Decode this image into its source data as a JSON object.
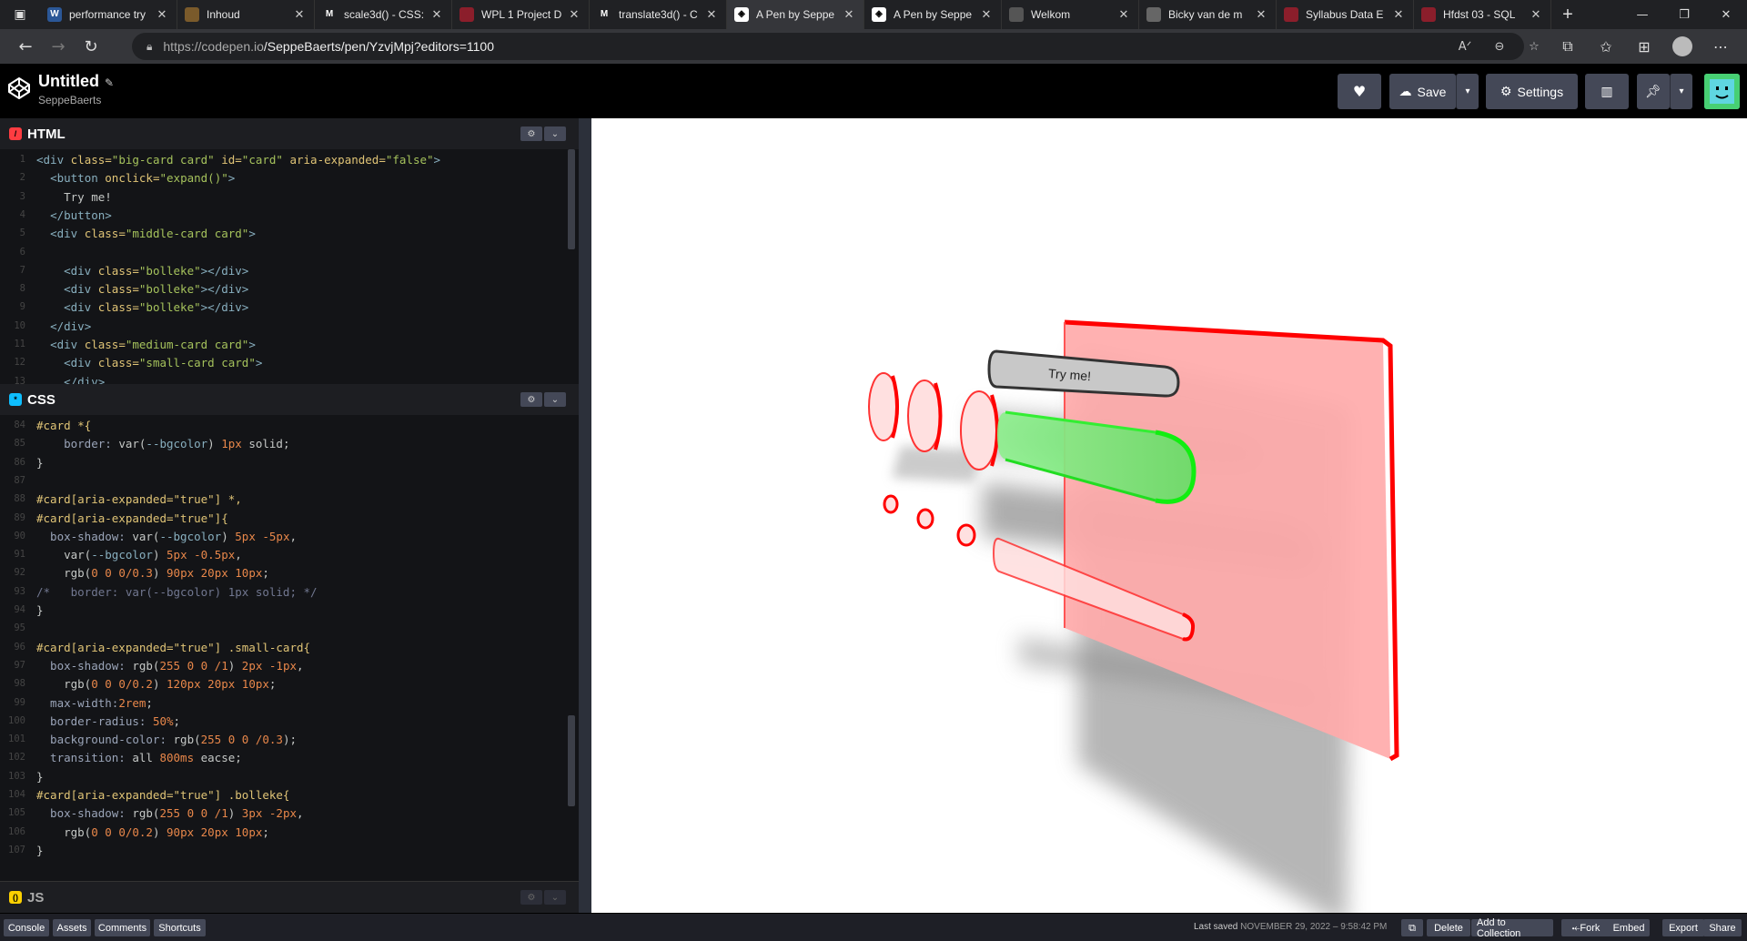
{
  "browser": {
    "tabs": [
      {
        "title": "performance try",
        "favicon": "W",
        "favicon_bg": "#2b5797",
        "active": false
      },
      {
        "title": "Inhoud",
        "favicon": "",
        "favicon_bg": "#7a5a2b",
        "active": false
      },
      {
        "title": "scale3d() - CSS:",
        "favicon": "M",
        "favicon_bg": "#202124",
        "active": false
      },
      {
        "title": "WPL 1 Project D",
        "favicon": "",
        "favicon_bg": "#8b1e2b",
        "active": false
      },
      {
        "title": "translate3d() - C",
        "favicon": "M",
        "favicon_bg": "#202124",
        "active": false
      },
      {
        "title": "A Pen by Seppe",
        "favicon": "◈",
        "favicon_bg": "#fff",
        "active": true
      },
      {
        "title": "A Pen by Seppe",
        "favicon": "◈",
        "favicon_bg": "#fff",
        "active": false
      },
      {
        "title": "Welkom",
        "favicon": "",
        "favicon_bg": "#555",
        "active": false
      },
      {
        "title": "Bicky van de m",
        "favicon": "",
        "favicon_bg": "#666",
        "active": false
      },
      {
        "title": "Syllabus Data E",
        "favicon": "",
        "favicon_bg": "#8b1e2b",
        "active": false
      },
      {
        "title": "Hfdst 03 - SQL",
        "favicon": "",
        "favicon_bg": "#8b1e2b",
        "active": false
      }
    ],
    "url_host": "https://codepen.io",
    "url_path": "/SeppeBaerts/pen/YzvjMpj?editors=1100"
  },
  "header": {
    "title": "Untitled",
    "author": "SeppeBaerts",
    "save_label": "Save",
    "settings_label": "Settings"
  },
  "panes": {
    "html_label": "HTML",
    "css_label": "CSS",
    "js_label": "JS"
  },
  "html_code": [
    {
      "n": "1",
      "t": [
        [
          "tag",
          "<div "
        ],
        [
          "attr",
          "class="
        ],
        [
          "str",
          "\"big-card card\" "
        ],
        [
          "attr",
          "id="
        ],
        [
          "str",
          "\"card\" "
        ],
        [
          "attr",
          "aria-expanded="
        ],
        [
          "str",
          "\"false\""
        ],
        [
          "tag",
          ">"
        ]
      ]
    },
    {
      "n": "2",
      "t": [
        [
          "punc",
          "  "
        ],
        [
          "tag",
          "<button "
        ],
        [
          "attr",
          "onclick="
        ],
        [
          "str",
          "\"expand()\""
        ],
        [
          "tag",
          ">"
        ]
      ]
    },
    {
      "n": "3",
      "t": [
        [
          "punc",
          "    Try me!"
        ]
      ]
    },
    {
      "n": "4",
      "t": [
        [
          "punc",
          "  "
        ],
        [
          "tag",
          "</button>"
        ]
      ]
    },
    {
      "n": "5",
      "t": [
        [
          "punc",
          "  "
        ],
        [
          "tag",
          "<div "
        ],
        [
          "attr",
          "class="
        ],
        [
          "str",
          "\"middle-card card\""
        ],
        [
          "tag",
          ">"
        ]
      ]
    },
    {
      "n": "6",
      "t": [
        [
          "punc",
          ""
        ]
      ]
    },
    {
      "n": "7",
      "t": [
        [
          "punc",
          "    "
        ],
        [
          "tag",
          "<div "
        ],
        [
          "attr",
          "class="
        ],
        [
          "str",
          "\"bolleke\""
        ],
        [
          "tag",
          "></div>"
        ]
      ]
    },
    {
      "n": "8",
      "t": [
        [
          "punc",
          "    "
        ],
        [
          "tag",
          "<div "
        ],
        [
          "attr",
          "class="
        ],
        [
          "str",
          "\"bolleke\""
        ],
        [
          "tag",
          "></div>"
        ]
      ]
    },
    {
      "n": "9",
      "t": [
        [
          "punc",
          "    "
        ],
        [
          "tag",
          "<div "
        ],
        [
          "attr",
          "class="
        ],
        [
          "str",
          "\"bolleke\""
        ],
        [
          "tag",
          "></div>"
        ]
      ]
    },
    {
      "n": "10",
      "t": [
        [
          "punc",
          "  "
        ],
        [
          "tag",
          "</div>"
        ]
      ]
    },
    {
      "n": "11",
      "t": [
        [
          "punc",
          "  "
        ],
        [
          "tag",
          "<div "
        ],
        [
          "attr",
          "class="
        ],
        [
          "str",
          "\"medium-card card\""
        ],
        [
          "tag",
          ">"
        ]
      ]
    },
    {
      "n": "12",
      "t": [
        [
          "punc",
          "    "
        ],
        [
          "tag",
          "<div "
        ],
        [
          "attr",
          "class="
        ],
        [
          "str",
          "\"small-card card\""
        ],
        [
          "tag",
          ">"
        ]
      ]
    },
    {
      "n": "13",
      "t": [
        [
          "punc",
          "    "
        ],
        [
          "tag",
          "</div>"
        ]
      ]
    }
  ],
  "css_code": [
    {
      "n": "84",
      "t": [
        [
          "sel",
          "#card *{"
        ]
      ]
    },
    {
      "n": "85",
      "t": [
        [
          "prop",
          "    border: "
        ],
        [
          "fn",
          "var("
        ],
        [
          "var",
          "--bgcolor"
        ],
        [
          "fn",
          ") "
        ],
        [
          "num",
          "1px "
        ],
        [
          "fn",
          "solid;"
        ]
      ]
    },
    {
      "n": "86",
      "t": [
        [
          "punc",
          "}"
        ]
      ]
    },
    {
      "n": "87",
      "t": [
        [
          "punc",
          ""
        ]
      ]
    },
    {
      "n": "88",
      "t": [
        [
          "sel",
          "#card[aria-expanded=\"true\"] *,"
        ]
      ]
    },
    {
      "n": "89",
      "t": [
        [
          "sel",
          "#card[aria-expanded=\"true\"]{"
        ]
      ]
    },
    {
      "n": "90",
      "t": [
        [
          "prop",
          "  box-shadow: "
        ],
        [
          "fn",
          "var("
        ],
        [
          "var",
          "--bgcolor"
        ],
        [
          "fn",
          ") "
        ],
        [
          "num",
          "5px -5px"
        ],
        [
          "fn",
          ","
        ]
      ]
    },
    {
      "n": "91",
      "t": [
        [
          "prop",
          "    "
        ],
        [
          "fn",
          "var("
        ],
        [
          "var",
          "--bgcolor"
        ],
        [
          "fn",
          ") "
        ],
        [
          "num",
          "5px -0.5px"
        ],
        [
          "fn",
          ","
        ]
      ]
    },
    {
      "n": "92",
      "t": [
        [
          "prop",
          "    "
        ],
        [
          "fn",
          "rgb("
        ],
        [
          "num",
          "0 0 0/0.3"
        ],
        [
          "fn",
          ") "
        ],
        [
          "num",
          "90px 20px 10px"
        ],
        [
          "fn",
          ";"
        ]
      ]
    },
    {
      "n": "93",
      "t": [
        [
          "cm",
          "/*   border: var(--bgcolor) 1px solid; */"
        ]
      ]
    },
    {
      "n": "94",
      "t": [
        [
          "punc",
          "}"
        ]
      ]
    },
    {
      "n": "95",
      "t": [
        [
          "punc",
          ""
        ]
      ]
    },
    {
      "n": "96",
      "t": [
        [
          "sel",
          "#card[aria-expanded=\"true\"] .small-card{"
        ]
      ]
    },
    {
      "n": "97",
      "t": [
        [
          "prop",
          "  box-shadow: "
        ],
        [
          "fn",
          "rgb("
        ],
        [
          "num",
          "255 0 0 /1"
        ],
        [
          "fn",
          ") "
        ],
        [
          "num",
          "2px -1px"
        ],
        [
          "fn",
          ","
        ]
      ]
    },
    {
      "n": "98",
      "t": [
        [
          "prop",
          "    "
        ],
        [
          "fn",
          "rgb("
        ],
        [
          "num",
          "0 0 0/0.2"
        ],
        [
          "fn",
          ") "
        ],
        [
          "num",
          "120px 20px 10px"
        ],
        [
          "fn",
          ";"
        ]
      ]
    },
    {
      "n": "99",
      "t": [
        [
          "prop",
          "  max-width:"
        ],
        [
          "num",
          "2rem"
        ],
        [
          "fn",
          ";"
        ]
      ]
    },
    {
      "n": "100",
      "t": [
        [
          "prop",
          "  border-radius: "
        ],
        [
          "num",
          "50%"
        ],
        [
          "fn",
          ";"
        ]
      ]
    },
    {
      "n": "101",
      "t": [
        [
          "prop",
          "  background-color: "
        ],
        [
          "fn",
          "rgb("
        ],
        [
          "num",
          "255 0 0 /0.3"
        ],
        [
          "fn",
          ");"
        ]
      ]
    },
    {
      "n": "102",
      "t": [
        [
          "prop",
          "  transition: "
        ],
        [
          "fn",
          "all "
        ],
        [
          "num",
          "800ms "
        ],
        [
          "fn",
          "eacse;"
        ]
      ]
    },
    {
      "n": "103",
      "t": [
        [
          "punc",
          "}"
        ]
      ]
    },
    {
      "n": "104",
      "t": [
        [
          "sel",
          "#card[aria-expanded=\"true\"] .bolleke{"
        ]
      ]
    },
    {
      "n": "105",
      "t": [
        [
          "prop",
          "  box-shadow: "
        ],
        [
          "fn",
          "rgb("
        ],
        [
          "num",
          "255 0 0 /1"
        ],
        [
          "fn",
          ") "
        ],
        [
          "num",
          "3px -2px"
        ],
        [
          "fn",
          ","
        ]
      ]
    },
    {
      "n": "106",
      "t": [
        [
          "prop",
          "    "
        ],
        [
          "fn",
          "rgb("
        ],
        [
          "num",
          "0 0 0/0.2"
        ],
        [
          "fn",
          ") "
        ],
        [
          "num",
          "90px 20px 10px"
        ],
        [
          "fn",
          ";"
        ]
      ]
    },
    {
      "n": "107",
      "t": [
        [
          "punc",
          "}"
        ]
      ]
    }
  ],
  "preview": {
    "button_label": "Try me!",
    "accent_red": "#ff0000",
    "accent_green": "#22ee22"
  },
  "footer": {
    "buttons": [
      "Console",
      "Assets",
      "Comments",
      "Shortcuts"
    ],
    "last_saved_label": "Last saved",
    "last_saved_date": "NOVEMBER 29, 2022 – 9:58:42 PM",
    "right_buttons": [
      "Delete",
      "Add to Collection",
      "Fork",
      "Embed",
      "Export",
      "Share"
    ]
  }
}
